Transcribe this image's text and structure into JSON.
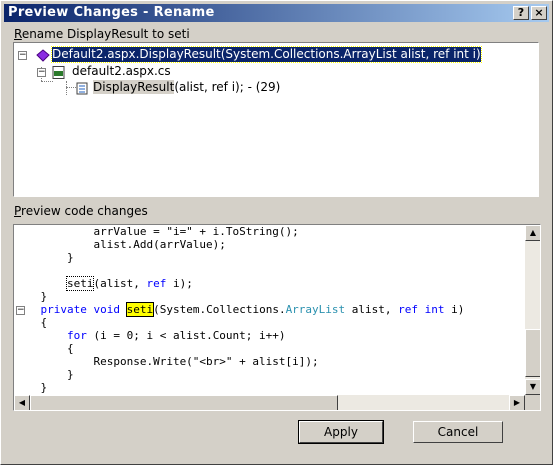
{
  "window": {
    "title": "Preview Changes - Rename",
    "help_button": "?",
    "close_button": "×"
  },
  "rename_label_prefix": "R",
  "rename_label_rest": "ename DisplayResult to seti",
  "tree": {
    "items": [
      {
        "text": "Default2.aspx.DisplayResult(System.Collections.ArrayList alist, ref int i)",
        "selected": true,
        "icon": "method-purple-icon"
      },
      {
        "text": "default2.aspx.cs",
        "icon": "csharp-file-icon"
      },
      {
        "text_highlight": "DisplayResult",
        "text_rest": "(alist, ref i); - (29)",
        "icon": "reference-icon"
      }
    ]
  },
  "preview_label_prefix": "P",
  "preview_label_rest": "review code changes",
  "code": {
    "lines": [
      "            arrValue = \"i=\" + i.ToString();",
      "            alist.Add(arrValue);",
      "        }",
      "",
      "        seti(alist, ref i);",
      "    }",
      "    private void seti(System.Collections.ArrayList alist, ref int i)",
      "    {",
      "        for (i = 0; i < alist.Count; i++)",
      "        {",
      "            Response.Write(\"<br>\" + alist[i]);",
      "        }",
      "    }"
    ]
  },
  "buttons": {
    "apply": "Apply",
    "cancel": "Cancel"
  }
}
